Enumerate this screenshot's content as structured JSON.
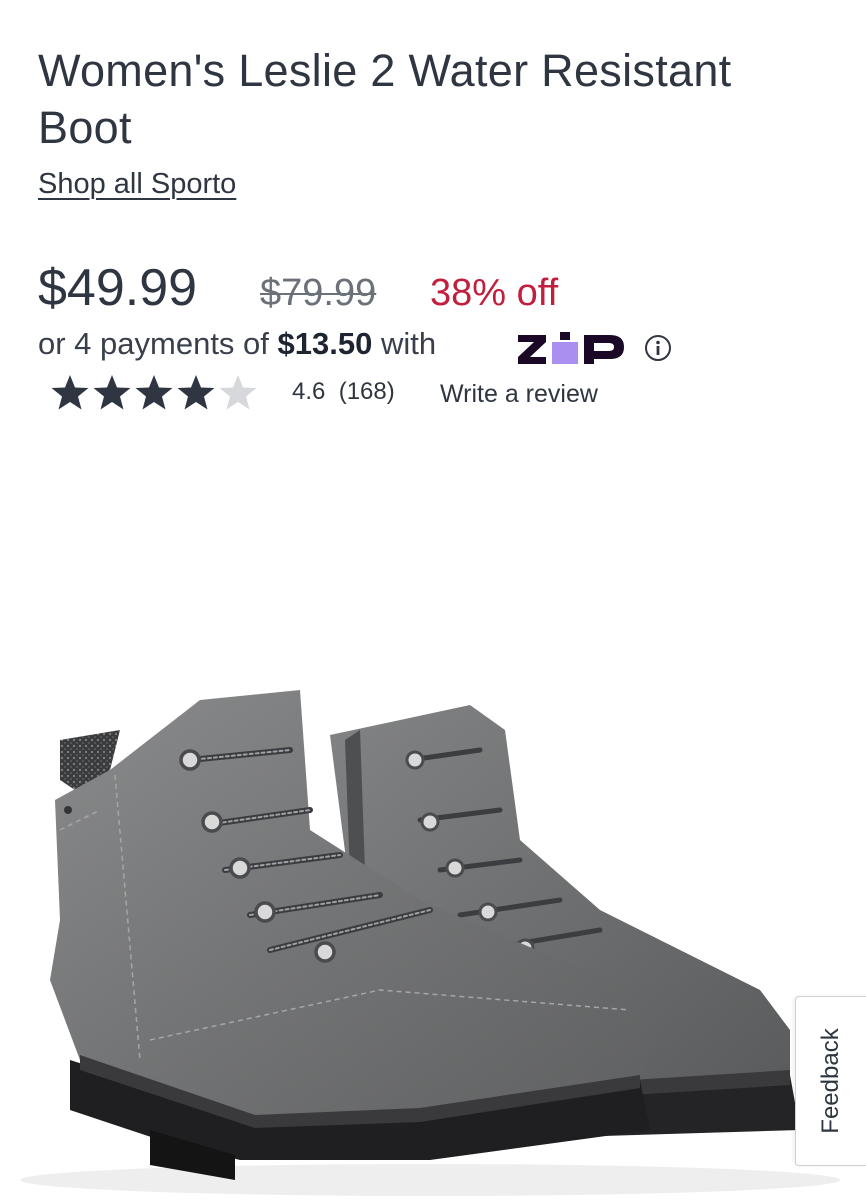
{
  "product": {
    "title": "Women's Leslie 2 Water Resistant Boot",
    "brand_link": "Shop all Sporto",
    "image_icon": "boot-photo"
  },
  "pricing": {
    "current": "$49.99",
    "original": "$79.99",
    "discount": "38% off",
    "installment_prefix": "or 4 payments of ",
    "installment_amount": "$13.50",
    "installment_suffix": " with",
    "provider_logo": "Zip",
    "info_icon": "info-icon"
  },
  "rating": {
    "score_text": "4.6",
    "count_text": "(168)",
    "stars_value": 4.6,
    "stars_max": 5,
    "write_review": "Write a review"
  },
  "feedback": {
    "label": "Feedback"
  },
  "colors": {
    "text": "#2f3642",
    "discount": "#c0203e",
    "zip_purple": "#aa8ff0",
    "zip_dark": "#1a0826"
  }
}
